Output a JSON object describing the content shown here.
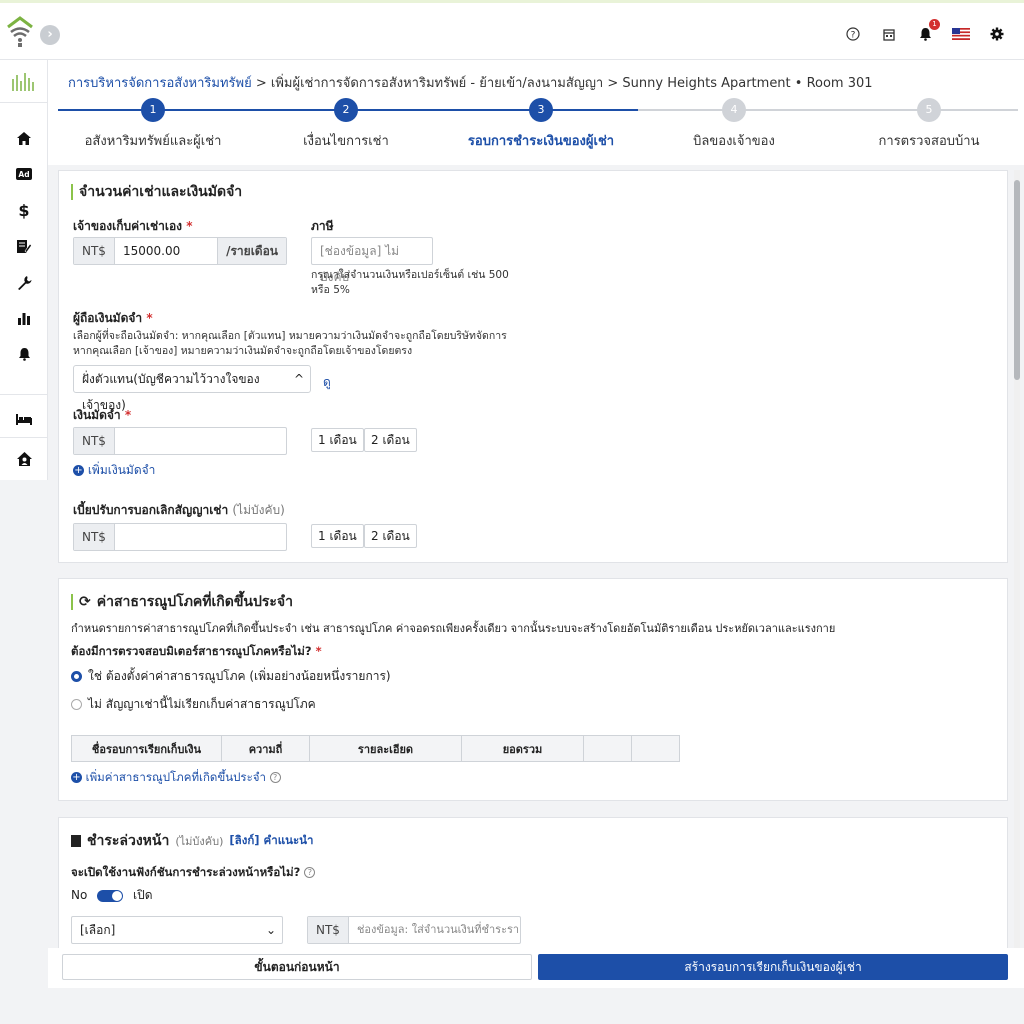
{
  "breadcrumb": {
    "root": "การบริหารจัดการอสังหาริมทรัพย์",
    "sep1": ">",
    "mid": "เพิ่มผู้เช่าการจัดการอสังหาริมทรัพย์ - ย้ายเข้า/ลงนามสัญญา",
    "sep2": ">",
    "current": "Sunny Heights Apartment • Room 301"
  },
  "steps": [
    {
      "num": "1",
      "label": "อสังหาริมทรัพย์และผู้เช่า",
      "state": "done"
    },
    {
      "num": "2",
      "label": "เงื่อนไขการเช่า",
      "state": "done"
    },
    {
      "num": "3",
      "label": "รอบการชำระเงินของผู้เช่า",
      "state": "active"
    },
    {
      "num": "4",
      "label": "บิลของเจ้าของ",
      "state": "todo"
    },
    {
      "num": "5",
      "label": "การตรวจสอบบ้าน",
      "state": "todo"
    }
  ],
  "rent": {
    "title": "จำนวนค่าเช่าและเงินมัดจำ",
    "rent_label": "เจ้าของเก็บค่าเช่าเอง",
    "req": "*",
    "currency": "NT$",
    "rent_value": "15000.00",
    "per_month": "/รายเดือน",
    "tax_label": "ภาษี",
    "tax_placeholder": "[ช่องข้อมูล] ไม่บังคับ",
    "tax_hint_1": "กรุณาใส่จำนวนเงินหรือเปอร์เซ็นต์ เช่น 500",
    "tax_hint_2": "หรือ 5%",
    "holder_label": "ผู้ถือเงินมัดจำ",
    "holder_help_1": "เลือกผู้ที่จะถือเงินมัดจำ: หากคุณเลือก [ตัวแทน] หมายความว่าเงินมัดจำจะถูกถือโดยบริษัทจัดการ",
    "holder_help_2": "หากคุณเลือก [เจ้าของ] หมายความว่าเงินมัดจำจะถูกถือโดยเจ้าของโดยตรง",
    "holder_selected": "ฝั่งตัวแทน(บัญชีความไว้วางใจของเจ้าของ)",
    "holder_link": "ดู",
    "deposit_label": "เงินมัดจำ",
    "month1": "1 เดือน",
    "month2": "2 เดือน",
    "add_deposit": "เพิ่มเงินมัดจำ",
    "penalty_label": "เบี้ยปรับการบอกเลิกสัญญาเช่า",
    "optional": "(ไม่บังคับ)"
  },
  "utility": {
    "title": "ค่าสาธารณูปโภคที่เกิดขึ้นประจำ",
    "desc": "กำหนดรายการค่าสาธารณูปโภคที่เกิดขึ้นประจำ เช่น สาธารณูปโภค ค่าจอดรถเพียงครั้งเดียว จากนั้นระบบจะสร้างโดยอัตโนมัติรายเดือน ประหยัดเวลาและแรงกาย",
    "question": "ต้องมีการตรวจสอบมิเตอร์สาธารณูปโภคหรือไม่?",
    "req": "*",
    "opt_yes": "ใช่ ต้องตั้งค่าค่าสาธารณูปโภค (เพิ่มอย่างน้อยหนึ่งรายการ)",
    "opt_no": "ไม่ สัญญาเช่านี้ไม่เรียกเก็บค่าสาธารณูปโภค",
    "columns": [
      "ชื่อรอบการเรียกเก็บเงิน",
      "ความถี่",
      "รายละเอียด",
      "ยอดรวม",
      "",
      ""
    ],
    "add_link": "เพิ่มค่าสาธารณูปโภคที่เกิดขึ้นประจำ"
  },
  "prepay": {
    "title": "ชำระล่วงหน้า",
    "optional": "(ไม่บังคับ)",
    "link": "[ลิงก์] คำแนะนำ",
    "question": "จะเปิดใช้งานฟังก์ชันการชำระล่วงหน้าหรือไม่?",
    "no": "No",
    "on": "เปิด",
    "select": "[เลือก]",
    "currency": "NT$",
    "amount_placeholder": "ช่องข้อมูล: ใส่จำนวนเงินที่ชำระราย"
  },
  "footer": {
    "prev": "ขั้นตอนก่อนหน้า",
    "next": "สร้างรอบการเรียกเก็บเงินของผู้เช่า"
  },
  "notif_count": "1",
  "colors": {
    "primary": "#1d4fa8",
    "accent": "#8bc34a",
    "badge": "#d32f2f"
  }
}
